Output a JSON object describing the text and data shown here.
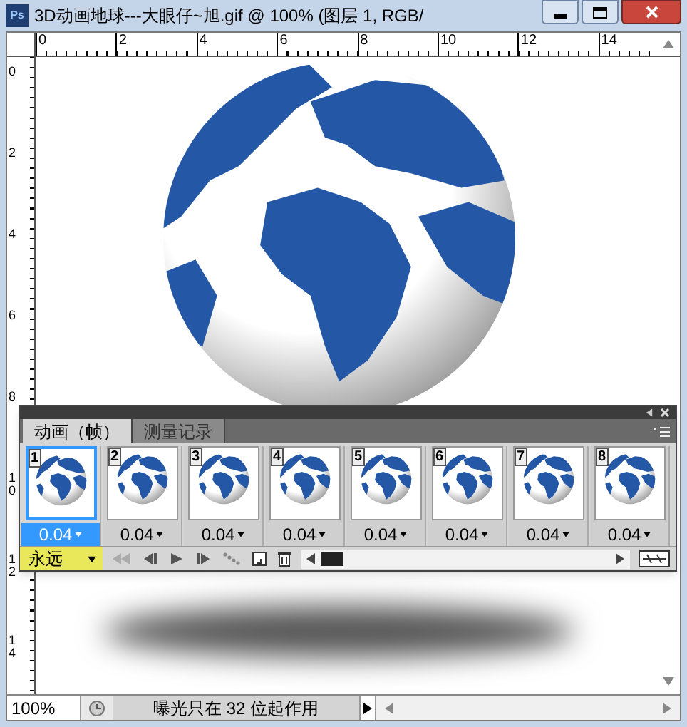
{
  "window": {
    "app_icon": "Ps",
    "title": "3D动画地球---大眼仔~旭.gif @ 100% (图层 1, RGB/"
  },
  "rulers": {
    "horizontal": [
      "0",
      "2",
      "4",
      "6",
      "8",
      "10",
      "12",
      "14"
    ],
    "vertical": [
      "0",
      "2",
      "4",
      "6",
      "8",
      "10",
      "12",
      "14"
    ]
  },
  "animation_panel": {
    "tabs": [
      {
        "label": "动画（帧）",
        "selected": true
      },
      {
        "label": "测量记录",
        "selected": false
      }
    ],
    "frames": [
      {
        "number": "1",
        "delay": "0.04",
        "selected": true
      },
      {
        "number": "2",
        "delay": "0.04",
        "selected": false
      },
      {
        "number": "3",
        "delay": "0.04",
        "selected": false
      },
      {
        "number": "4",
        "delay": "0.04",
        "selected": false
      },
      {
        "number": "5",
        "delay": "0.04",
        "selected": false
      },
      {
        "number": "6",
        "delay": "0.04",
        "selected": false
      },
      {
        "number": "7",
        "delay": "0.04",
        "selected": false
      },
      {
        "number": "8",
        "delay": "0.04",
        "selected": false
      }
    ],
    "loop": "永远"
  },
  "status_bar": {
    "zoom": "100%",
    "message": "曝光只在 32 位起作用"
  }
}
